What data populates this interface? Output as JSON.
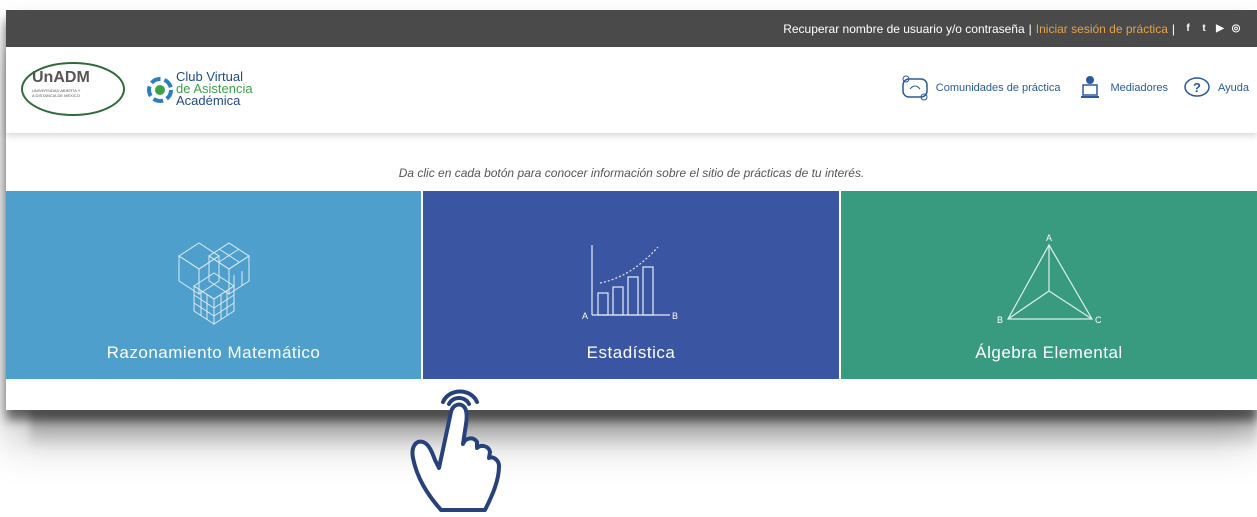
{
  "topbar": {
    "recover_label": "Recuperar nombre de usuario y/o contraseña",
    "separator": "|",
    "practice_login_label": "Iniciar sesión de práctica",
    "social_icons": [
      "facebook-icon",
      "twitter-icon",
      "youtube-icon",
      "instagram-icon"
    ],
    "social_glyphs": [
      "f",
      "t",
      "▶",
      "◎"
    ]
  },
  "header": {
    "logo_unadm_main": "UnADM",
    "logo_unadm_sub1": "UNIVERSIDAD ABIERTA Y",
    "logo_unadm_sub2": "A DISTANCIA DE MÉXICO",
    "logo_club_line1": "Club Virtual",
    "logo_club_line2": "de Asistencia",
    "logo_club_line3": "Académica",
    "nav": [
      {
        "label": "Comunidades de práctica",
        "icon": "community-icon"
      },
      {
        "label": "Mediadores",
        "icon": "mediator-icon"
      },
      {
        "label": "Ayuda",
        "icon": "help-icon"
      }
    ]
  },
  "main": {
    "instruction": "Da clic en cada botón para conocer información sobre el sitio de prácticas de tu interés.",
    "tiles": [
      {
        "label": "Razonamiento Matemático",
        "icon": "cubes-icon",
        "color": "#4f9fcd"
      },
      {
        "label": "Estadística",
        "icon": "bar-chart-icon",
        "color": "#3a55a2",
        "axis_labels": [
          "A",
          "B"
        ]
      },
      {
        "label": "Álgebra Elemental",
        "icon": "triangle-pyramid-icon",
        "color": "#389a7e",
        "vertex_labels": [
          "A",
          "B",
          "C"
        ]
      }
    ]
  },
  "overlay": {
    "icon": "pointing-hand-icon"
  }
}
